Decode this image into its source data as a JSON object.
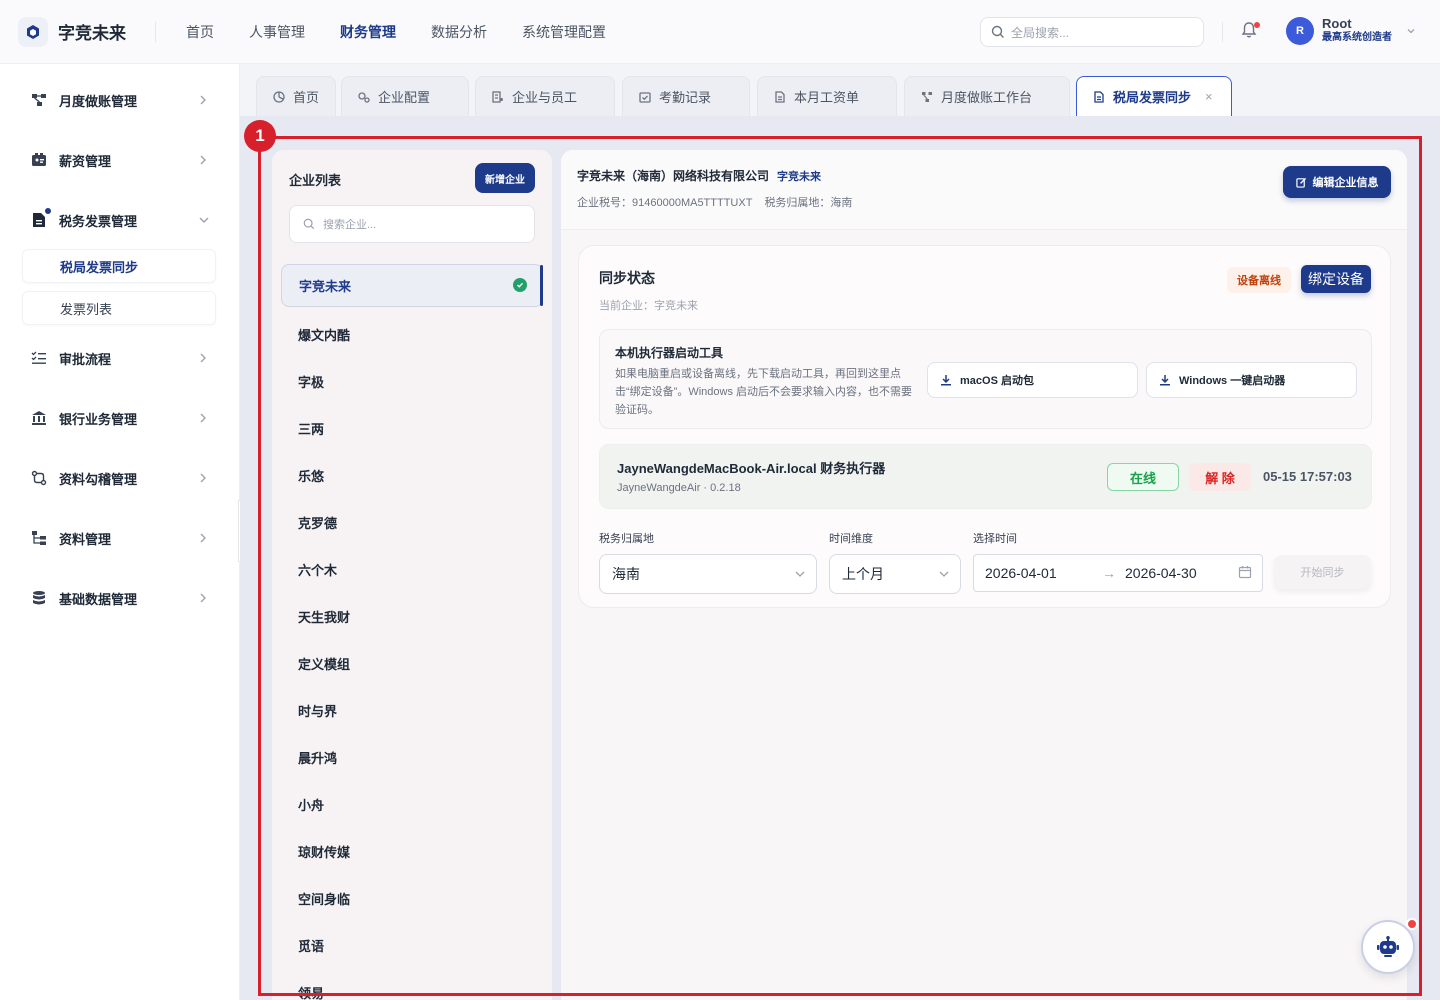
{
  "brand": {
    "name": "字竞未来"
  },
  "topnav": [
    {
      "label": "首页"
    },
    {
      "label": "人事管理"
    },
    {
      "label": "财务管理",
      "active": true
    },
    {
      "label": "数据分析"
    },
    {
      "label": "系统管理配置"
    }
  ],
  "search": {
    "placeholder": "全局搜索..."
  },
  "user": {
    "avatar": "R",
    "name": "Root",
    "role": "最高系统创造者"
  },
  "sidebar": {
    "items": [
      {
        "label": "月度做账管理",
        "icon": "flow-icon"
      },
      {
        "label": "薪资管理",
        "icon": "wallet-icon"
      },
      {
        "label": "税务发票管理",
        "icon": "invoice-icon",
        "expanded": true
      },
      {
        "label": "审批流程",
        "icon": "checklist-icon"
      },
      {
        "label": "银行业务管理",
        "icon": "bank-icon"
      },
      {
        "label": "资料勾稽管理",
        "icon": "link-icon"
      },
      {
        "label": "资料管理",
        "icon": "folder-tree-icon"
      },
      {
        "label": "基础数据管理",
        "icon": "database-icon"
      }
    ],
    "subitems": [
      {
        "label": "税局发票同步",
        "active": true
      },
      {
        "label": "发票列表"
      }
    ]
  },
  "tabs": [
    {
      "label": "首页"
    },
    {
      "label": "企业配置"
    },
    {
      "label": "企业与员工"
    },
    {
      "label": "考勤记录"
    },
    {
      "label": "本月工资单"
    },
    {
      "label": "月度做账工作台"
    },
    {
      "label": "税局发票同步",
      "active": true,
      "close": "×"
    }
  ],
  "highlight": {
    "badge": "1"
  },
  "company_list": {
    "title": "企业列表",
    "add_label": "新增企业",
    "search_placeholder": "搜索企业...",
    "items": [
      "字竞未来",
      "爆文内酷",
      "字极",
      "三两",
      "乐悠",
      "克罗德",
      "六个木",
      "天生我财",
      "定义模组",
      "时与界",
      "晨升鸿",
      "小舟",
      "琼财传媒",
      "空间身临",
      "觅语",
      "领易"
    ]
  },
  "company": {
    "name": "字竞未来（海南）网络科技有限公司",
    "tag": "字竞未来",
    "tax_id": "企业税号：91460000MA5TTTTUXT",
    "region": "税务归属地：海南",
    "edit_label": "编辑企业信息"
  },
  "sync": {
    "title": "同步状态",
    "subtitle": "当前企业：字竞未来",
    "offline_label": "设备离线",
    "bind_label": "绑定设备",
    "tool": {
      "title": "本机执行器启动工具",
      "desc": "如果电脑重启或设备离线，先下载启动工具，再回到这里点击“绑定设备”。Windows 启动后不会要求输入内容，也不需要验证码。",
      "mac_label": "macOS 启动包",
      "win_label": "Windows 一键启动器"
    },
    "executor": {
      "name": "JayneWangdeMacBook-Air.local 财务执行器",
      "version": "JayneWangdeAir · 0.2.18",
      "status": "在线",
      "unbind": "解 除",
      "time": "05-15 17:57:03"
    },
    "form": {
      "region_label": "税务归属地",
      "region_value": "海南",
      "period_label": "时间维度",
      "period_value": "上个月",
      "date_label": "选择时间",
      "start_date": "2026-04-01",
      "end_date": "2026-04-30",
      "arrow": "→",
      "start_label": "开始同步"
    }
  },
  "colors": {
    "primary": "#1e3a8a",
    "highlight": "#d6202b",
    "online": "#16a34a",
    "danger": "#dc2626"
  }
}
